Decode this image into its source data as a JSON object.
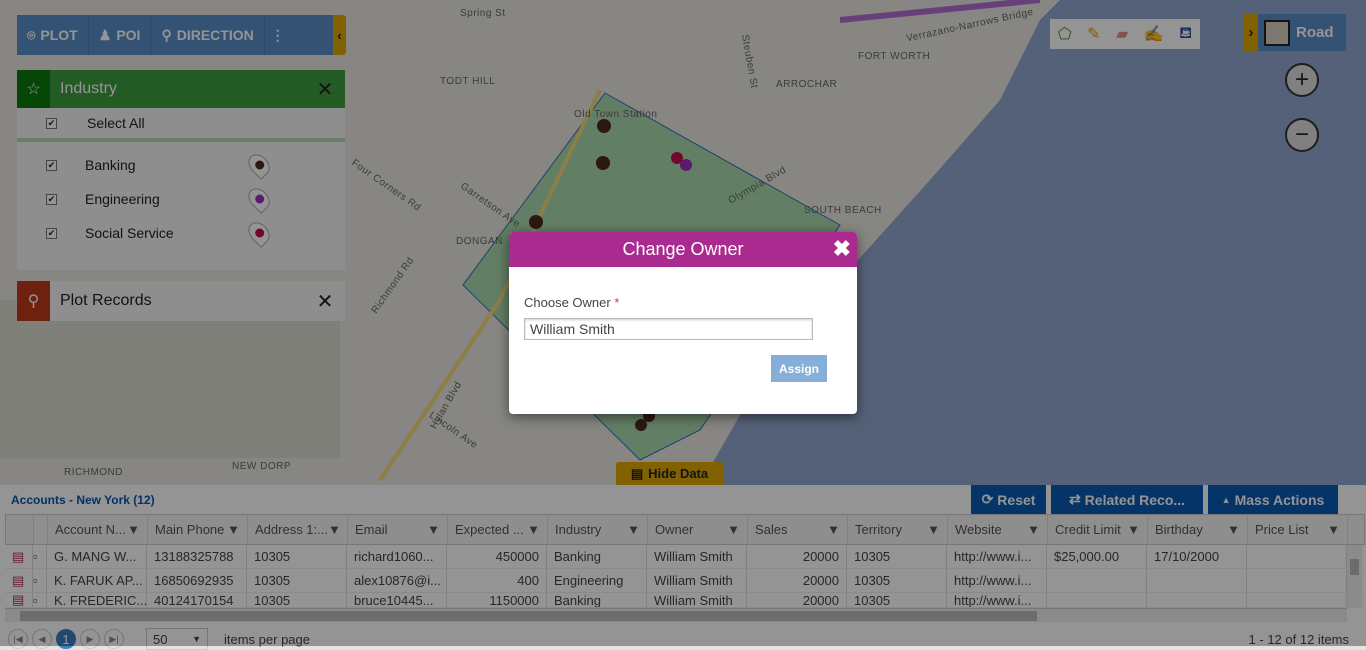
{
  "map": {
    "labels": [
      "Spring St",
      "TODT HILL",
      "ARROCHAR",
      "FORT WORTH",
      "SOUTH BEACH",
      "DONGAN",
      "RICHMOND",
      "NEW DORP",
      "Old Town Station",
      "Hylan Blvd",
      "Steuben St",
      "Verrazano-Narrows Bridge",
      "Richmond Rd",
      "Four Corners Rd",
      "Garretson Ave",
      "Olympia Blvd",
      "Lincoln Ave",
      "Todt Hill"
    ],
    "colors": {
      "land": "#e9e7e0",
      "water": "#93a8cf",
      "polygon": "#7ed08a"
    }
  },
  "toolbar": {
    "plot": "PLOT",
    "poi": "POI",
    "direction": "DIRECTION"
  },
  "industry_panel": {
    "title": "Industry",
    "select_all": "Select All",
    "items": [
      {
        "label": "Banking",
        "color": "#4a2a20"
      },
      {
        "label": "Engineering",
        "color": "#9b30c0"
      },
      {
        "label": "Social Service",
        "color": "#c0104a"
      }
    ]
  },
  "plot_records": {
    "title": "Plot Records"
  },
  "hide_data": "Hide Data",
  "layer": {
    "label": "Road"
  },
  "bottom": {
    "title": "Accounts - New York (12)",
    "reset": "Reset",
    "related": "Related Reco...",
    "mass": "Mass Actions",
    "columns": [
      "Account N...",
      "Main Phone",
      "Address 1:...",
      "Email",
      "Expected ...",
      "Industry",
      "Owner",
      "Sales",
      "Territory",
      "Website",
      "Credit Limit",
      "Birthday",
      "Price List"
    ],
    "rows": [
      [
        "G. MANG W...",
        "13188325788",
        "10305",
        "richard1060...",
        "450000",
        "Banking",
        "William Smith",
        "20000",
        "10305",
        "http://www.i...",
        "$25,000.00",
        "17/10/2000",
        ""
      ],
      [
        "K. FARUK AP...",
        "16850692935",
        "10305",
        "alex10876@i...",
        "400",
        "Engineering",
        "William Smith",
        "20000",
        "10305",
        "http://www.i...",
        "",
        "",
        ""
      ],
      [
        "K. FREDERIC...",
        "40124170154",
        "10305",
        "bruce10445...",
        "1150000",
        "Banking",
        "William Smith",
        "20000",
        "10305",
        "http://www.i...",
        "",
        "",
        ""
      ]
    ],
    "pager": {
      "page": "1",
      "per_page": "50",
      "per_page_label": "items per page",
      "summary": "1 - 12 of 12 items"
    }
  },
  "dialog": {
    "title": "Change Owner",
    "label": "Choose Owner",
    "required": "*",
    "value": "William Smith",
    "assign": "Assign"
  }
}
